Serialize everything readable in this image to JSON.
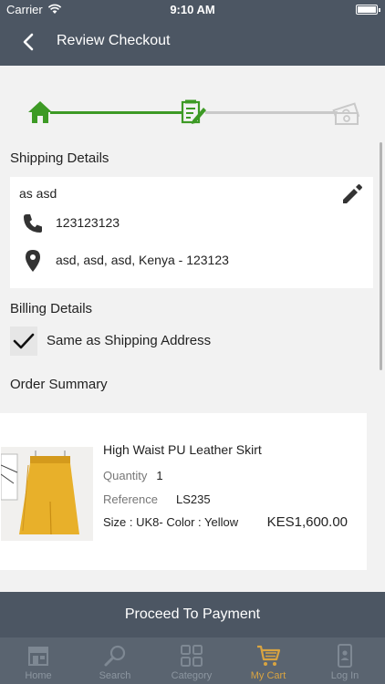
{
  "status_bar": {
    "carrier": "Carrier",
    "time": "9:10 AM"
  },
  "nav": {
    "title": "Review Checkout"
  },
  "stepper": {
    "current_step": 2,
    "total_steps": 3
  },
  "shipping": {
    "title": "Shipping Details",
    "name": "as asd",
    "phone": "123123123",
    "address": "asd, asd, asd, Kenya - 123123"
  },
  "billing": {
    "title": "Billing Details",
    "same_as_shipping_label": "Same as Shipping Address",
    "same_as_shipping_checked": true
  },
  "order": {
    "title": "Order Summary",
    "item": {
      "name": "High Waist PU Leather Skirt",
      "quantity_label": "Quantity",
      "quantity": "1",
      "reference_label": "Reference",
      "reference": "LS235",
      "size_color": "Size : UK8- Color : Yellow",
      "price": "KES1,600.00"
    }
  },
  "proceed_label": "Proceed To Payment",
  "tabs": [
    {
      "label": "Home",
      "icon": "store-icon"
    },
    {
      "label": "Search",
      "icon": "search-icon"
    },
    {
      "label": "Category",
      "icon": "grid-icon"
    },
    {
      "label": "My Cart",
      "icon": "cart-icon",
      "active": true
    },
    {
      "label": "Log In",
      "icon": "user-phone-icon"
    }
  ],
  "colors": {
    "header": "#4c5663",
    "tabbar": "#5a6470",
    "step_active": "#3d9a25",
    "step_inactive": "#c9c9c9",
    "tab_active": "#d9a441"
  }
}
